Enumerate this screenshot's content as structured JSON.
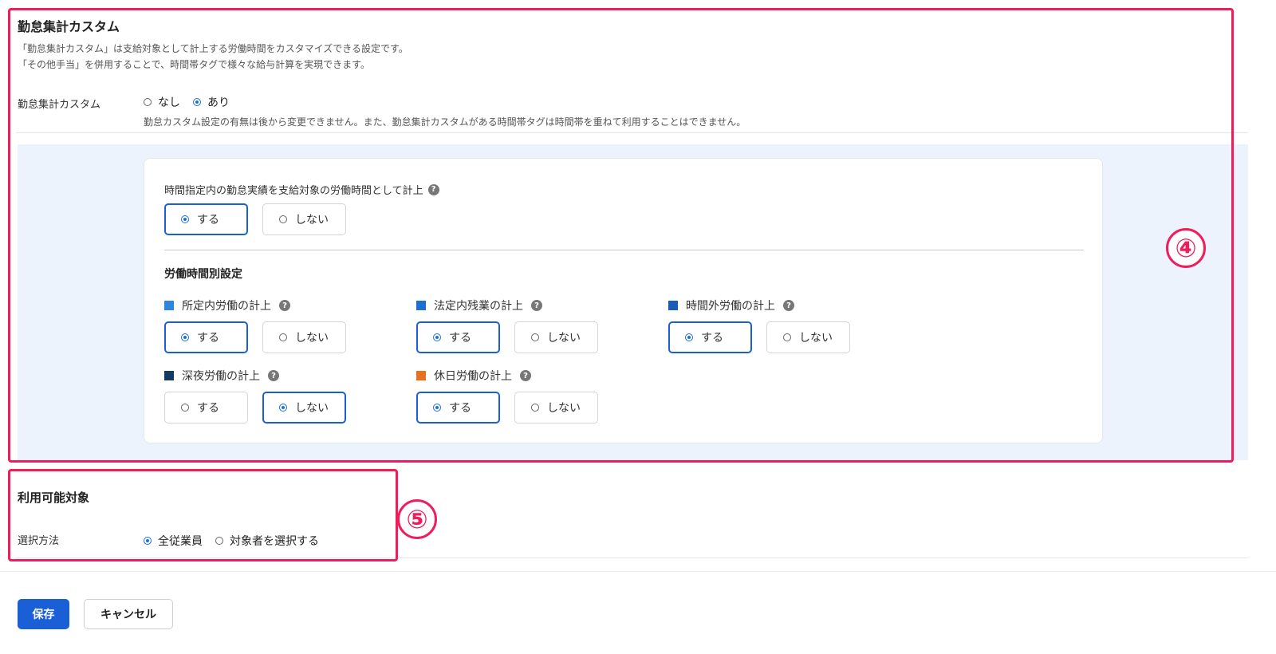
{
  "custom_section": {
    "title": "勤怠集計カスタム",
    "desc_line1": "「勤怠集計カスタム」は支給対象として計上する労働時間をカスタマイズできる設定です。",
    "desc_line2": "「その他手当」を併用することで、時間帯タグで様々な給与計算を実現できます。",
    "field_label": "勤怠集計カスタム",
    "option_none": "なし",
    "option_yes": "あり",
    "selected": "あり",
    "note": "勤怠カスタム設定の有無は後から変更できません。また、勤怠集計カスタムがある時間帯タグは時間帯を重ねて利用することはできません。"
  },
  "card": {
    "time_spec_label": "時間指定内の勤怠実績を支給対象の労働時間として計上",
    "time_spec": {
      "yes": "する",
      "no": "しない",
      "selected": "する"
    },
    "sub_title": "労働時間別設定",
    "categories": [
      {
        "label": "所定内労働の計上",
        "color": "#2f86e0",
        "yes": "する",
        "no": "しない",
        "selected": "する"
      },
      {
        "label": "法定内残業の計上",
        "color": "#1f6fd0",
        "yes": "する",
        "no": "しない",
        "selected": "する"
      },
      {
        "label": "時間外労働の計上",
        "color": "#1a5cb8",
        "yes": "する",
        "no": "しない",
        "selected": "する"
      },
      {
        "label": "深夜労働の計上",
        "color": "#123a63",
        "yes": "する",
        "no": "しない",
        "selected": "しない"
      },
      {
        "label": "休日労働の計上",
        "color": "#e8701e",
        "yes": "する",
        "no": "しない",
        "selected": "する"
      }
    ]
  },
  "available_section": {
    "title": "利用可能対象",
    "field_label": "選択方法",
    "option_all": "全従業員",
    "option_select": "対象者を選択する",
    "selected": "全従業員"
  },
  "annotations": {
    "badge4": "④",
    "badge5": "⑤",
    "color": "#ee1d5c"
  },
  "footer": {
    "save": "保存",
    "cancel": "キャンセル"
  }
}
